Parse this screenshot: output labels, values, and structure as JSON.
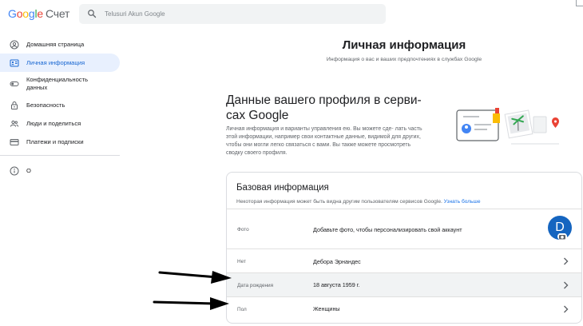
{
  "header": {
    "logo_letters": [
      "G",
      "o",
      "o",
      "g",
      "l",
      "e"
    ],
    "product": "Счет",
    "search_placeholder": "Telusuri Akun Google"
  },
  "sidebar": {
    "items": [
      {
        "label": "Домашняя страница",
        "icon": "account-circle-icon"
      },
      {
        "label": "Личная информация",
        "icon": "id-card-icon",
        "active": true
      },
      {
        "label": "Конфиденциальность данных",
        "icon": "toggle-icon"
      },
      {
        "label": "Безопасность",
        "icon": "lock-icon"
      },
      {
        "label": "Люди и поделиться",
        "icon": "people-icon"
      },
      {
        "label": "Платежи и подписки",
        "icon": "credit-card-icon"
      }
    ],
    "footer_item": {
      "label": "О",
      "icon": "info-icon"
    }
  },
  "main": {
    "title": "Личная информация",
    "subtitle": "Информация о вас и ваших предпочтениях в службах Google",
    "profile_heading": "Данные вашего профиля в серви- сах Google",
    "profile_desc": "Личная информация и варианты управления ею. Вы можете сде- лать часть этой информации, например свои контактные данные, видимой для других, чтобы они могли легко связаться с вами. Вы также можете просмотреть сводку своего профиля."
  },
  "card": {
    "title": "Базовая информация",
    "subtitle": "Некоторая информация может быть видна другим пользователям сервисов Google.",
    "learn_more": "Узнать больше",
    "avatar_letter": "D",
    "rows": [
      {
        "label": "Фото",
        "value": "Добавьте фото, чтобы персонализировать свой аккаунт"
      },
      {
        "label": "Нет",
        "value": "Дебора Эрнандес"
      },
      {
        "label": "Дата рождения",
        "value": "18 августа 1959 г."
      },
      {
        "label": "Пол",
        "value": "Женщины"
      }
    ]
  },
  "colors": {
    "accent": "#1967d2",
    "active_bg": "#e8f0fe",
    "avatar": "#1565c0",
    "highlight_row": "#f1f3f4"
  }
}
